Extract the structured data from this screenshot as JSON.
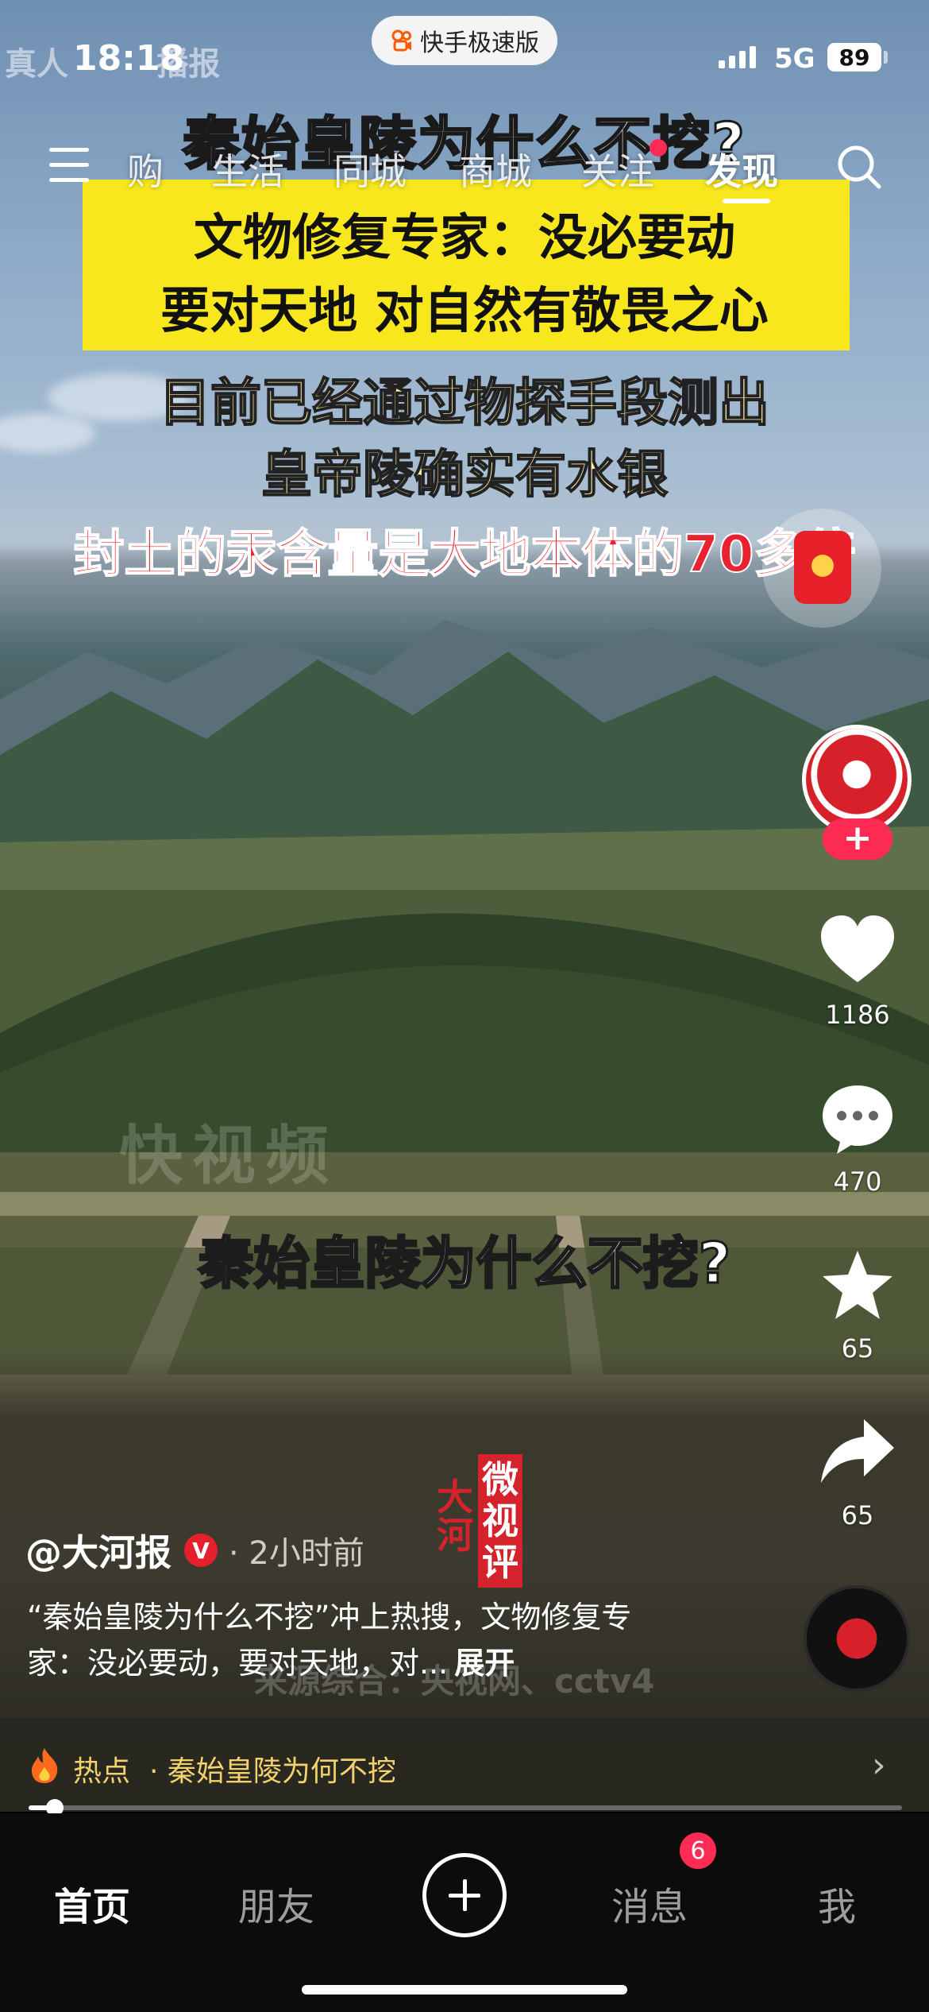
{
  "status_bar": {
    "time": "18:18",
    "app_name": "快手极速版",
    "network": "5G",
    "battery": "89"
  },
  "video": {
    "overlay_top": "真人",
    "overlay_top_right": "播报",
    "caption_title": "秦始皇陵为什么不挖?",
    "caption_yellow_1": "文物修复专家：没必要动",
    "caption_yellow_2": "要对天地 对自然有敬畏之心",
    "caption_white_1": "目前已经通过物探手段测出",
    "caption_white_2": "皇帝陵确实有水银",
    "caption_red": "封土的汞含量是大地本体的70多倍",
    "caption_bottom": "秦始皇陵为什么不挖?",
    "watermark": "快视频",
    "stamp_left": "大河",
    "stamp_right": "微视评",
    "source": "来源综合：央视网、cctv4"
  },
  "top_nav": {
    "tabs": [
      "购",
      "生活",
      "同城",
      "商城",
      "关注",
      "发现"
    ],
    "active_tab": "发现"
  },
  "rail": {
    "like_count": "1186",
    "comment_count": "470",
    "favorite_count": "65",
    "share_count": "65",
    "follow_label": "+"
  },
  "post": {
    "author": "@大河报",
    "verified_label": "V",
    "time_ago": "· 2小时前",
    "description": "“秦始皇陵为什么不挖”冲上热搜，文物修复专家：没必要动，要对天地，对...",
    "expand_label": "展开"
  },
  "hot": {
    "label": "热点",
    "topic": "· 秦始皇陵为何不挖",
    "progress": 0.03
  },
  "bottom_nav": {
    "home": "首页",
    "friends": "朋友",
    "messages": "消息",
    "messages_badge": "6",
    "me": "我"
  }
}
